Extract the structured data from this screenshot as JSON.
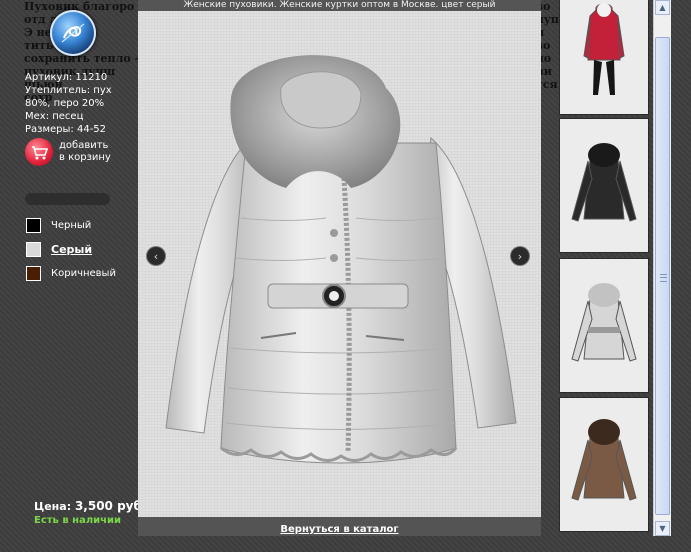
{
  "background_text": {
    "lines": [
      "Пуховик благоро",
      "отд           лее тё",
      "Э           незав",
      "           тить к",
      "сохранить тепло –",
      "     пуховик лучш",
      "           шьюн",
      "           сохр"
    ],
    "right_lines": [
      "зо",
      "луш",
      "и",
      "зо",
      "ло",
      "ли",
      "тся"
    ]
  },
  "product": {
    "specs": [
      "Артикул: 11210",
      "Утеплитель: пух",
      "80%, перо 20%",
      "Мех: песец",
      "Размеры: 44-52"
    ],
    "add_to_cart_line1": "добавить",
    "add_to_cart_line2": "в корзину",
    "price_label": "Цена:",
    "price_value": "3,500 руб.",
    "stock": "Есть в наличии"
  },
  "colors": [
    {
      "name": "Черный",
      "hex": "#000000",
      "selected": false
    },
    {
      "name": "Серый",
      "hex": "#d9d9d9",
      "selected": true
    },
    {
      "name": "Коричневый",
      "hex": "#4a1e05",
      "selected": false
    }
  ],
  "lightbox": {
    "title": "Женские пуховики. Женские куртки оптом в Москве. цвет серый",
    "back_link": "Вернуться в каталог",
    "prev_icon": "‹",
    "next_icon": "›"
  },
  "thumbnails": [
    {
      "color": "#c3203a",
      "fur": "#f2f2f2",
      "label": "red-jacket"
    },
    {
      "color": "#2a2a2a",
      "fur": "#1a1a1a",
      "label": "black-jacket"
    },
    {
      "color": "#d6d6d6",
      "fur": "#c2c2c2",
      "label": "grey-jacket"
    },
    {
      "color": "#7b5a45",
      "fur": "#3d2a1e",
      "label": "brown-jacket"
    }
  ],
  "scrollbar": {
    "up": "▲",
    "down": "▼"
  }
}
